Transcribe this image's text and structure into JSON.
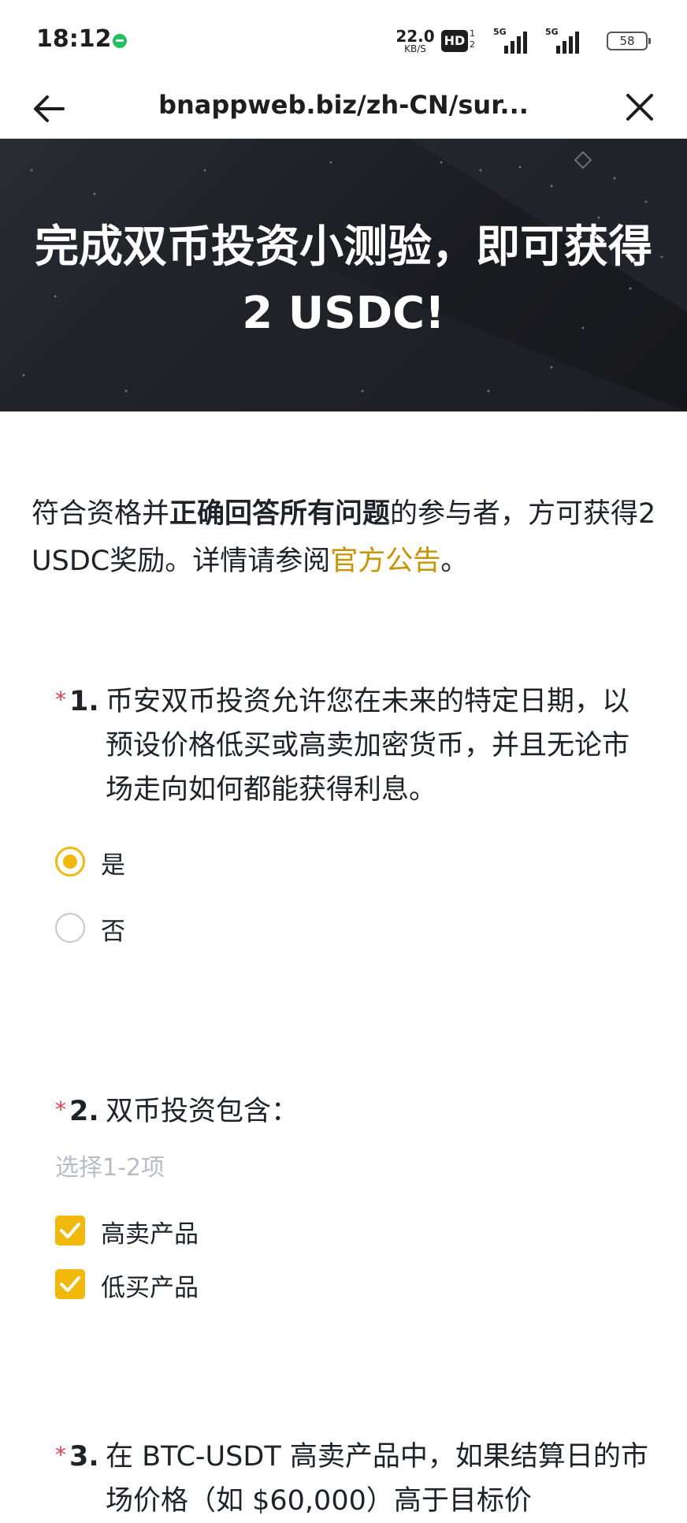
{
  "status_bar": {
    "time": "18:12",
    "net_speed": "22.0",
    "net_unit": "KB/S",
    "hd_label": "HD",
    "hd_sub1": "1",
    "hd_sub2": "2",
    "signal1_tag": "5G",
    "signal2_tag": "5G",
    "battery": "58"
  },
  "browser": {
    "url": "bnappweb.biz/zh-CN/sur..."
  },
  "hero": {
    "title": "完成双币投资小测验，即可获得 2 USDC!"
  },
  "intro": {
    "part1": "符合资格并",
    "bold": "正确回答所有问题",
    "part2": "的参与者，方可获得2 USDC奖励。详情请参阅",
    "link": "官方公告",
    "part3": "。"
  },
  "questions": [
    {
      "star": "*",
      "number": "1.",
      "text": "币安双币投资允许您在未来的特定日期，以预设价格低买或高卖加密货币，并且无论市场走向如何都能获得利息。",
      "options": [
        {
          "label": "是",
          "checked": true
        },
        {
          "label": "否",
          "checked": false
        }
      ]
    },
    {
      "star": "*",
      "number": "2.",
      "text": "双币投资包含：",
      "hint": "选择1-2项",
      "options": [
        {
          "label": "高卖产品",
          "checked": true
        },
        {
          "label": "低买产品",
          "checked": true
        }
      ]
    },
    {
      "star": "*",
      "number": "3.",
      "text": "在 BTC-USDT 高卖产品中，如果结算日的市场价格（如 $60,000）高于目标价"
    }
  ],
  "colors": {
    "accent": "#f0b90b",
    "link": "#c99400",
    "required_star": "#e0404f",
    "hero_bg": "#1c1d22"
  }
}
